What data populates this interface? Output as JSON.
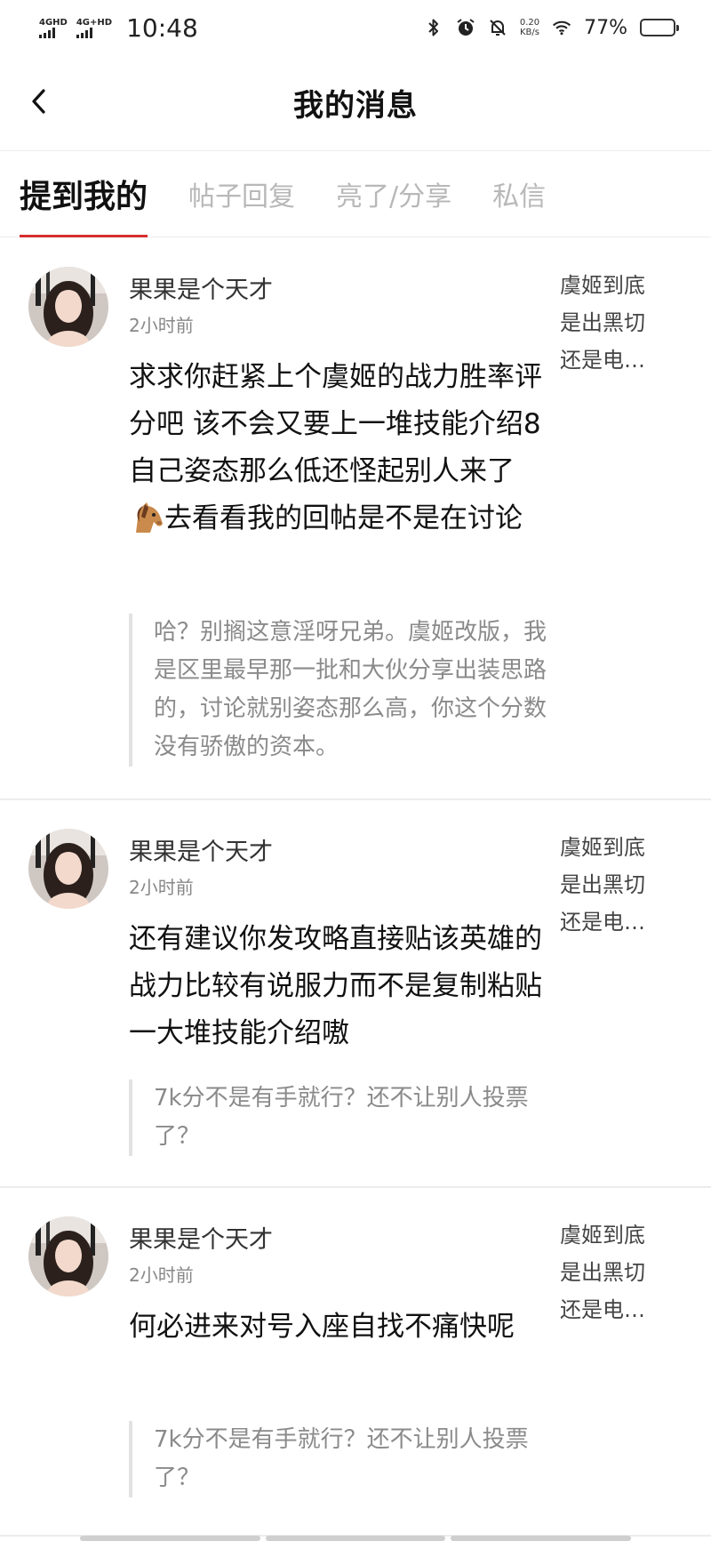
{
  "status_bar": {
    "sim1": "4GHD",
    "sim2": "4G+HD",
    "time": "10:48",
    "net_speed_value": "0.20",
    "net_speed_unit": "KB/s",
    "battery_percent": "77%",
    "battery_level": 0.77,
    "icons": [
      "bluetooth-icon",
      "alarm-icon",
      "mute-icon",
      "wifi-icon",
      "battery-icon"
    ]
  },
  "header": {
    "title": "我的消息",
    "back_icon": "chevron-left-icon"
  },
  "tabs": [
    {
      "label": "提到我的",
      "active": true
    },
    {
      "label": "帖子回复",
      "active": false
    },
    {
      "label": "亮了/分享",
      "active": false
    },
    {
      "label": "私信",
      "active": false
    }
  ],
  "messages": [
    {
      "user": "果果是个天才",
      "time": "2小时前",
      "ref": [
        "虞姬到底",
        "是出黑切",
        "还是电…"
      ],
      "content_before_emoji": "求求你赶紧上个虞姬的战力胜率评分吧 该不会又要上一堆技能介绍8　自己姿态那么低还怪起别人来了",
      "emoji": "horse-emoji",
      "content_after_emoji": "去看看我的回帖是不是在讨论",
      "quote": "哈？别搁这意淫呀兄弟。虞姬改版，我是区里最早那一批和大伙分享出装思路的，讨论就别姿态那么高，你这个分数没有骄傲的资本。"
    },
    {
      "user": "果果是个天才",
      "time": "2小时前",
      "ref": [
        "虞姬到底",
        "是出黑切",
        "还是电…"
      ],
      "content": "还有建议你发攻略直接贴该英雄的战力比较有说服力而不是复制粘贴一大堆技能介绍嗷",
      "quote": "7k分不是有手就行？还不让别人投票了？"
    },
    {
      "user": "果果是个天才",
      "time": "2小时前",
      "ref": [
        "虞姬到底",
        "是出黑切",
        "还是电…"
      ],
      "content": "何必进来对号入座自找不痛快呢",
      "quote": "7k分不是有手就行？还不让别人投票了？"
    }
  ]
}
